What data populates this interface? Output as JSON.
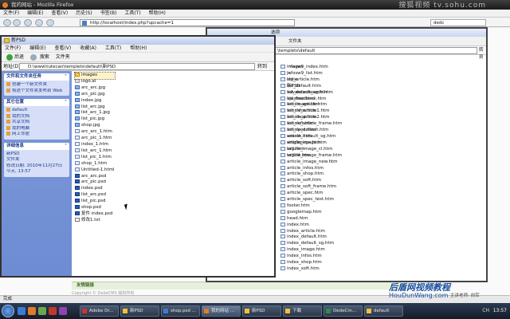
{
  "browser": {
    "title": "我的网站 - Mozilla Firefox",
    "watermark": "搜狐视频 tv.sohu.com",
    "menu": [
      "文件(F)",
      "编辑(E)",
      "查看(V)",
      "历史(S)",
      "书签(B)",
      "工具(T)",
      "帮助(H)"
    ],
    "url": "http://localhost/index.php?upcache=1",
    "tab2": "dedc",
    "footer_heading": "友情链接",
    "footer_text": "Copyright © DedeCMS 版权所有",
    "status": "完成",
    "brand": "后盾网视频教程",
    "brand_url": "HouDunWang.com",
    "brand_sub": "主讲老师: 向军"
  },
  "explorer2": {
    "title_hint": "选项",
    "toolbar": [
      "文件夹"
    ],
    "address": "\\templets\\default",
    "go": "转到",
    "col1": [
      "images",
      "js",
      "style",
      "新PSD",
      "advancedsearch.htm",
      "ajaxfeedback.htm",
      "article_article.htm",
      "article_article1.htm",
      "article_article2.htm",
      "article_article_frame.htm",
      "article_default.htm",
      "article_default_sg.htm",
      "article_image.htm",
      "article_image_cl.htm",
      "article_image_frame.htm",
      "article_image_new.htm",
      "article_infos.htm",
      "article_shop.htm",
      "article_soft.htm",
      "article_soft_frame.htm",
      "article_spec.htm",
      "article_spec_test.htm",
      "footer.htm",
      "googlemap.htm",
      "head.htm",
      "index.htm",
      "index_article.htm",
      "index_default.htm",
      "index_default_sg.htm",
      "index_image.htm",
      "index_infos.htm",
      "index_shop.htm",
      "index_soft.htm"
    ],
    "col2": [
      "infosw9_index.htm",
      "infosw9_list.htm",
      "list_article.htm",
      "list_default.htm",
      "list_default_sg.htm",
      "list_free.htm",
      "list_image.htm",
      "list_infos.htm",
      "list_shop.htm",
      "list_soft.htm",
      "list_spec.htm",
      "search.htm",
      "singlepage.htm",
      "tag.htm",
      "taglist.htm"
    ]
  },
  "explorer1": {
    "title": "新PSD",
    "menu": [
      "文件(F)",
      "编辑(E)",
      "查看(V)",
      "收藏(A)",
      "工具(T)",
      "帮助(H)"
    ],
    "toolbar": [
      "后退",
      "搜索",
      "文件夹"
    ],
    "address_label": "地址(D)",
    "address": "D:\\www\\tutecan\\templets\\default\\新PSD",
    "go": "转到",
    "panels": [
      {
        "title": "文件和文件夹任务",
        "items": [
          "创建一个新文件夹",
          "将这个文件夹发布到 Web"
        ]
      },
      {
        "title": "其它位置",
        "items": [
          "default",
          "我的文档",
          "共享文档",
          "我的电脑",
          "网上邻居"
        ]
      },
      {
        "title": "详细信息",
        "items": [
          "新PSD",
          "文件夹",
          "修改日期: 2010年11月27日",
          "今天, 13:57"
        ]
      }
    ],
    "files": [
      {
        "name": "images",
        "type": "folder"
      },
      {
        "name": "logo.ai",
        "type": "ai"
      },
      {
        "name": "arc_arc.jpg",
        "type": "jpg"
      },
      {
        "name": "arc_pic.jpg",
        "type": "jpg"
      },
      {
        "name": "index.jpg",
        "type": "jpg"
      },
      {
        "name": "list_arc.jpg",
        "type": "jpg"
      },
      {
        "name": "list_arc_1.jpg",
        "type": "jpg"
      },
      {
        "name": "list_pic.jpg",
        "type": "jpg"
      },
      {
        "name": "shop.jpg",
        "type": "jpg"
      },
      {
        "name": "arc_arc_1.htm",
        "type": "htm"
      },
      {
        "name": "arc_pic_1.htm",
        "type": "htm"
      },
      {
        "name": "index_1.htm",
        "type": "htm"
      },
      {
        "name": "list_arc_1.htm",
        "type": "htm"
      },
      {
        "name": "list_pic_1.htm",
        "type": "htm"
      },
      {
        "name": "shop_1.htm",
        "type": "htm"
      },
      {
        "name": "Untitled-1.html",
        "type": "htm"
      },
      {
        "name": "arc_arc.psd",
        "type": "psd"
      },
      {
        "name": "arc_pic.psd",
        "type": "psd"
      },
      {
        "name": "index.psd",
        "type": "psd"
      },
      {
        "name": "list_arc.psd",
        "type": "psd"
      },
      {
        "name": "list_pic.psd",
        "type": "psd"
      },
      {
        "name": "shop.psd",
        "type": "psd"
      },
      {
        "name": "复件 index.psd",
        "type": "psd"
      },
      {
        "name": "修改1.txt",
        "type": "txt"
      }
    ]
  },
  "taskbar": {
    "items": [
      "Adobe Dr...",
      "新PSD",
      "shop.psd ...",
      "我的网站 ...",
      "新PSD",
      "下载",
      "DedeCm...",
      "default"
    ],
    "tray": "CH",
    "clock": "13:57"
  }
}
